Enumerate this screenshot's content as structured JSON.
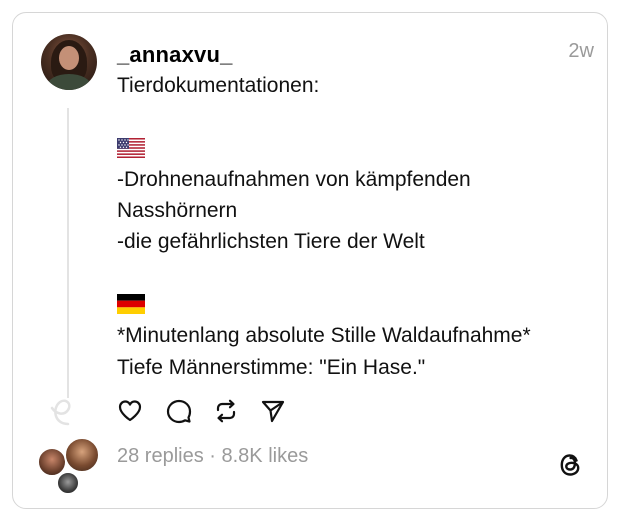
{
  "post": {
    "username": "_annaxvu_",
    "time": "2w",
    "lines": [
      "Tierdokumentationen:",
      "",
      "",
      "-Drohnenaufnahmen von kämpfenden",
      "Nasshörnern",
      "-die gefährlichsten Tiere der Welt",
      "",
      "",
      "*Minutenlang absolute Stille Waldaufnahme*",
      "Tiefe Männerstimme: \"Ein Hase.\""
    ],
    "flags": [
      "us-flag-icon",
      "germany-flag-icon"
    ]
  },
  "actions": [
    {
      "name": "like-button",
      "icon": "heart-icon"
    },
    {
      "name": "comment-button",
      "icon": "comment-icon"
    },
    {
      "name": "repost-button",
      "icon": "repost-icon"
    },
    {
      "name": "share-button",
      "icon": "send-icon"
    }
  ],
  "stats": {
    "text": "28 replies · 8.8K likes"
  },
  "colors": {
    "border": "#d6d6d6",
    "muted": "#9a9a9a",
    "thread_line": "#e3e3e3"
  }
}
